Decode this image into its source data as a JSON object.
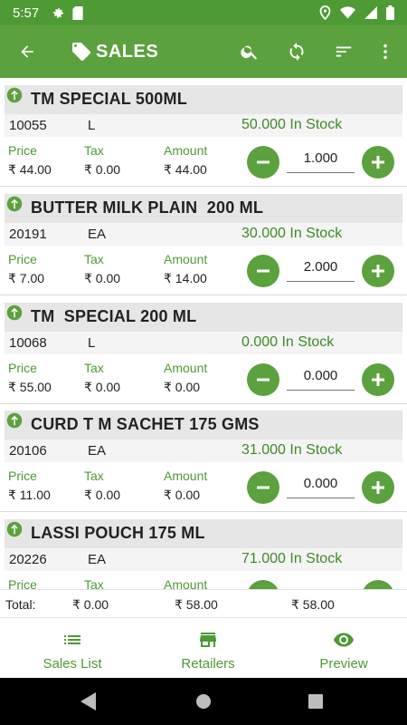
{
  "status_bar": {
    "time": "5:57"
  },
  "app_bar": {
    "title": "SALES"
  },
  "items": [
    {
      "name": "TM SPECIAL 500ML",
      "code": "10055",
      "unit": "L",
      "stock": "50.000 In Stock",
      "price_label": "Price",
      "tax_label": "Tax",
      "amount_label": "Amount",
      "price": "₹ 44.00",
      "tax": "₹ 0.00",
      "amount": "₹ 44.00",
      "qty": "1.000"
    },
    {
      "name": "BUTTER MILK PLAIN  200 ML",
      "code": "20191",
      "unit": "EA",
      "stock": "30.000 In Stock",
      "price_label": "Price",
      "tax_label": "Tax",
      "amount_label": "Amount",
      "price": "₹ 7.00",
      "tax": "₹ 0.00",
      "amount": "₹ 14.00",
      "qty": "2.000"
    },
    {
      "name": "TM  SPECIAL 200 ML",
      "code": "10068",
      "unit": "L",
      "stock": "0.000 In Stock",
      "price_label": "Price",
      "tax_label": "Tax",
      "amount_label": "Amount",
      "price": "₹ 55.00",
      "tax": "₹ 0.00",
      "amount": "₹ 0.00",
      "qty": "0.000"
    },
    {
      "name": "CURD T M SACHET 175 GMS",
      "code": "20106",
      "unit": "EA",
      "stock": "31.000 In Stock",
      "price_label": "Price",
      "tax_label": "Tax",
      "amount_label": "Amount",
      "price": "₹ 11.00",
      "tax": "₹ 0.00",
      "amount": "₹ 0.00",
      "qty": "0.000"
    },
    {
      "name": "LASSI POUCH 175 ML",
      "code": "20226",
      "unit": "EA",
      "stock": "71.000 In Stock",
      "price_label": "Price",
      "tax_label": "Tax",
      "amount_label": "Amount",
      "price": "",
      "tax": "",
      "amount": "",
      "qty": ""
    }
  ],
  "totals": {
    "label": "Total:",
    "tax": "₹ 0.00",
    "amount": "₹ 58.00",
    "net": "₹ 58.00"
  },
  "bottom_nav": [
    {
      "label": "Sales List",
      "icon": "list-icon"
    },
    {
      "label": "Retailers",
      "icon": "store-icon"
    },
    {
      "label": "Preview",
      "icon": "eye-icon"
    }
  ],
  "colors": {
    "primary": "#5ba13d",
    "status_bar": "#4e9a34",
    "stock_text": "#3d8b23"
  }
}
